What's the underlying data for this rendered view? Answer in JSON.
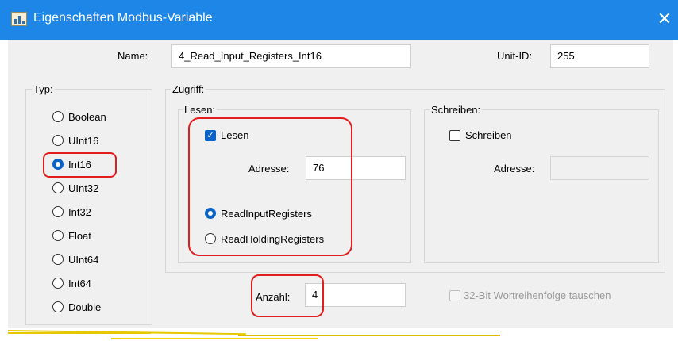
{
  "window": {
    "title": "Eigenschaften Modbus-Variable",
    "close_glyph": "✕"
  },
  "colors": {
    "title_bar": "#1e86e6",
    "client_bg": "#f0f0f0",
    "accent": "#0a64c8",
    "highlight": "#e11d1d"
  },
  "name": {
    "label": "Name:",
    "value": "4_Read_Input_Registers_Int16"
  },
  "unit_id": {
    "label": "Unit-ID:",
    "value": "255"
  },
  "typ": {
    "label": "Typ:",
    "options": [
      "Boolean",
      "UInt16",
      "Int16",
      "UInt32",
      "Int32",
      "Float",
      "UInt64",
      "Int64",
      "Double"
    ],
    "selected": "Int16"
  },
  "zugriff": {
    "label": "Zugriff:"
  },
  "lesen_group": {
    "label": "Lesen:",
    "checkbox_label": "Lesen",
    "checked": true,
    "address_label": "Adresse:",
    "address_value": "76",
    "mode_options": [
      "ReadInputRegisters",
      "ReadHoldingRegisters"
    ],
    "selected_mode": "ReadInputRegisters"
  },
  "schreiben_group": {
    "label": "Schreiben:",
    "checkbox_label": "Schreiben",
    "checked": false,
    "address_label": "Adresse:",
    "address_value": ""
  },
  "anzahl": {
    "label": "Anzahl:",
    "value": "4"
  },
  "swap_words": {
    "label": "32-Bit Wortreihenfolge tauschen",
    "checked": false,
    "enabled": false
  }
}
